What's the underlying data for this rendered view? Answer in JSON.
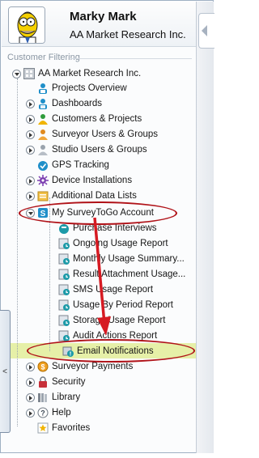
{
  "header": {
    "user_name": "Marky Mark",
    "company_name": "AA Market Research Inc."
  },
  "filter": {
    "label": "Customer Filtering"
  },
  "collapse_button": {
    "glyph": "<"
  },
  "tree": {
    "root": "AA Market Research Inc.",
    "items": [
      {
        "label": "Projects Overview",
        "icon": "projects-icon"
      },
      {
        "label": "Dashboards",
        "icon": "dashboards-icon"
      },
      {
        "label": "Customers & Projects",
        "icon": "customers-icon"
      },
      {
        "label": "Surveyor Users & Groups",
        "icon": "surveyor-users-icon"
      },
      {
        "label": "Studio Users & Groups",
        "icon": "studio-users-icon"
      },
      {
        "label": "GPS Tracking",
        "icon": "gps-icon"
      },
      {
        "label": "Device Installations",
        "icon": "devices-icon"
      },
      {
        "label": "Additional Data Lists",
        "icon": "data-lists-icon"
      },
      {
        "label": "My SurveyToGo Account",
        "icon": "account-icon"
      }
    ],
    "account_children": [
      {
        "label": "Purchase Interviews"
      },
      {
        "label": "Ongoing Usage Report"
      },
      {
        "label": "Monthly  Usage Summary..."
      },
      {
        "label": "Result Attachment Usage..."
      },
      {
        "label": "SMS Usage Report"
      },
      {
        "label": "Usage By Period Report"
      },
      {
        "label": "Storage Usage Report"
      },
      {
        "label": "Audit Actions Report"
      },
      {
        "label": "Email Notifications"
      }
    ],
    "bottom_items": [
      {
        "label": "Surveyor Payments",
        "icon": "payments-icon"
      },
      {
        "label": "Security",
        "icon": "security-icon"
      },
      {
        "label": "Library",
        "icon": "library-icon"
      },
      {
        "label": "Help",
        "icon": "help-icon"
      },
      {
        "label": "Favorites",
        "icon": "favorites-icon"
      }
    ]
  },
  "colors": {
    "highlight": "#e6f0a8",
    "annotation": "#b01218",
    "accent": "#1f8fc9"
  }
}
